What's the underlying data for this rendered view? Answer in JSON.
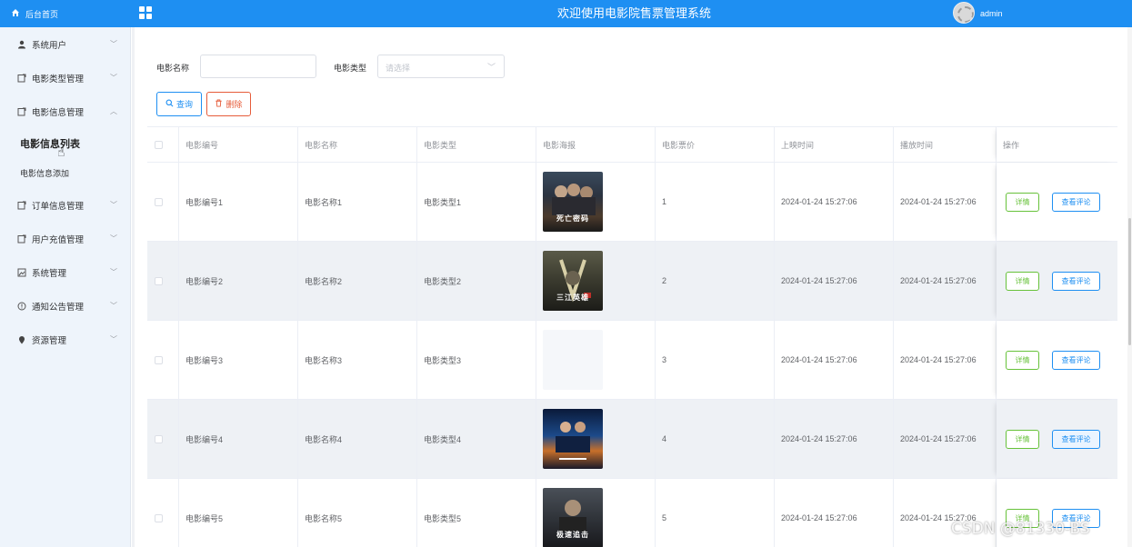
{
  "header": {
    "home_label": "后台首页",
    "title": "欢迎使用电影院售票管理系统",
    "user": "admin",
    "bg_color": "#1e8ff2"
  },
  "sidebar": {
    "items": [
      {
        "label": "系统用户",
        "icon": "user-icon"
      },
      {
        "label": "电影类型管理",
        "icon": "doc-edit-icon"
      },
      {
        "label": "电影信息管理",
        "icon": "doc-edit-icon",
        "expanded": true,
        "children": [
          {
            "label": "电影信息列表",
            "active": true
          },
          {
            "label": "电影信息添加",
            "active": false
          }
        ]
      },
      {
        "label": "订单信息管理",
        "icon": "doc-edit-icon"
      },
      {
        "label": "用户充值管理",
        "icon": "doc-edit-icon"
      },
      {
        "label": "系统管理",
        "icon": "picture-icon"
      },
      {
        "label": "通知公告管理",
        "icon": "info-icon"
      },
      {
        "label": "资源管理",
        "icon": "location-icon"
      }
    ]
  },
  "filters": {
    "name_label": "电影名称",
    "name_value": "",
    "type_label": "电影类型",
    "type_placeholder": "请选择"
  },
  "buttons": {
    "query": "查询",
    "delete": "删除"
  },
  "table": {
    "headers": [
      "电影编号",
      "电影名称",
      "电影类型",
      "电影海报",
      "电影票价",
      "上映时间",
      "播放时间",
      "操作"
    ],
    "rows": [
      {
        "id": "电影编号1",
        "name": "电影名称1",
        "type": "电影类型1",
        "poster": "dark-war",
        "poster_caption": "死亡密码",
        "price": "1",
        "release": "2024-01-24 15:27:06",
        "play": "2024-01-24 15:27:06"
      },
      {
        "id": "电影编号2",
        "name": "电影名称2",
        "type": "电影类型2",
        "poster": "dark-war",
        "poster_caption": "三江英雄",
        "price": "2",
        "release": "2024-01-24 15:27:06",
        "play": "2024-01-24 15:27:06"
      },
      {
        "id": "电影编号3",
        "name": "电影名称3",
        "type": "电影类型3",
        "poster": "empty",
        "poster_caption": "",
        "price": "3",
        "release": "2024-01-24 15:27:06",
        "play": "2024-01-24 15:27:06"
      },
      {
        "id": "电影编号4",
        "name": "电影名称4",
        "type": "电影类型4",
        "poster": "blue-sci",
        "poster_caption": "",
        "price": "4",
        "release": "2024-01-24 15:27:06",
        "play": "2024-01-24 15:27:06"
      },
      {
        "id": "电影编号5",
        "name": "电影名称5",
        "type": "电影类型5",
        "poster": "action",
        "poster_caption": "极速追击",
        "price": "5",
        "release": "2024-01-24 15:27:06",
        "play": "2024-01-24 15:27:06"
      }
    ],
    "action_detail": "详情",
    "action_review": "查看评论"
  },
  "watermark": "CSDN @81330-BS"
}
